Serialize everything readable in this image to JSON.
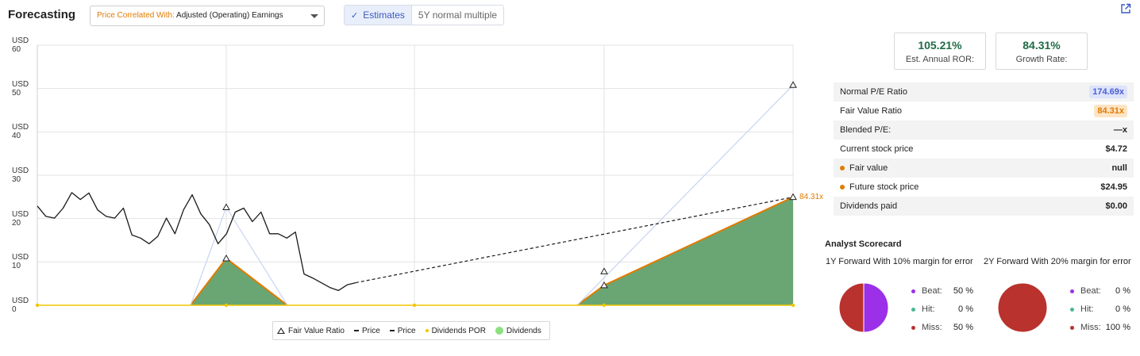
{
  "header": {
    "title": "Forecasting",
    "correlation_prefix": "Price Correlated With:",
    "correlation_value": "Adjusted (Operating) Earnings",
    "toggle_active": "Estimates",
    "toggle_inactive": "5Y normal multiple"
  },
  "chart_data": {
    "type": "line",
    "ylim": [
      0,
      60
    ],
    "y_ticks": [
      {
        "unit": "USD",
        "value": "0"
      },
      {
        "unit": "USD",
        "value": "10"
      },
      {
        "unit": "USD",
        "value": "20"
      },
      {
        "unit": "USD",
        "value": "30"
      },
      {
        "unit": "USD",
        "value": "40"
      },
      {
        "unit": "USD",
        "value": "50"
      },
      {
        "unit": "USD",
        "value": "60"
      }
    ],
    "grid": true,
    "series": [
      {
        "name": "Fair Value Ratio",
        "values": [
          22.6,
          10.8,
          4.6,
          7.8,
          50.8,
          24.95
        ]
      },
      {
        "name": "Price",
        "values": [
          22.9,
          20.5,
          20.1,
          22.4,
          26.0,
          24.4,
          25.9,
          22.0,
          20.5,
          20.1,
          22.4,
          16.2,
          15.5,
          14.2,
          15.9,
          20.1,
          16.5,
          22.0,
          25.5,
          21.1,
          18.6,
          14.2,
          16.5,
          21.5,
          22.4,
          19.3,
          21.5,
          16.5,
          16.5,
          15.5,
          16.9,
          7.2,
          6.3,
          5.2,
          4.1,
          3.4,
          4.7,
          5.2
        ]
      },
      {
        "name": "Price",
        "values": [
          5.2,
          24.95
        ]
      },
      {
        "name": "Dividends POR",
        "values": [
          0,
          0,
          0,
          0,
          0
        ]
      },
      {
        "name": "Dividends",
        "values": [
          0,
          10.8,
          0,
          0,
          4.6,
          24.95
        ]
      }
    ],
    "end_label": "84.31x",
    "legend": [
      "Fair Value Ratio",
      "Price",
      "Price",
      "Dividends POR",
      "Dividends"
    ]
  },
  "kpis": [
    {
      "value": "105.21%",
      "label": "Est. Annual ROR:"
    },
    {
      "value": "84.31%",
      "label": "Growth Rate:"
    }
  ],
  "metrics": [
    {
      "label": "Normal P/E Ratio",
      "value": "174.69x"
    },
    {
      "label": "Fair Value Ratio",
      "value": "84.31x"
    },
    {
      "label": "Blended P/E:",
      "value": "—x"
    },
    {
      "label": "Current stock price",
      "value": "$4.72"
    },
    {
      "label": "Fair value",
      "value": "null"
    },
    {
      "label": "Future stock price",
      "value": "$24.95"
    },
    {
      "label": "Dividends paid",
      "value": "$0.00"
    }
  ],
  "scorecard": {
    "title": "Analyst Scorecard",
    "groups": [
      {
        "title": "1Y Forward With 10% margin for error",
        "beat_label": "Beat:",
        "beat": "50 %",
        "hit_label": "Hit:",
        "hit": "0 %",
        "miss_label": "Miss:",
        "miss": "50 %",
        "beat_pct": 50,
        "hit_pct": 0,
        "miss_pct": 50
      },
      {
        "title": "2Y Forward With 20% margin for error",
        "beat_label": "Beat:",
        "beat": "0 %",
        "hit_label": "Hit:",
        "hit": "0 %",
        "miss_label": "Miss:",
        "miss": "100 %",
        "beat_pct": 0,
        "hit_pct": 0,
        "miss_pct": 100
      }
    ]
  },
  "colors": {
    "price": "#1a1a1a",
    "fair_value_fill": "#6aa673",
    "fair_value_line": "#e07b00",
    "estimate_line": "#c8d4f2",
    "dividends_por": "#f2c500",
    "beat": "#9b30e8",
    "hit": "#4ab897",
    "miss": "#b9322e",
    "kpi_green": "#1f6b45"
  },
  "icons": {
    "external_link": "external-link-icon",
    "dropdown": "chevron-down-icon",
    "check": "check-icon"
  }
}
